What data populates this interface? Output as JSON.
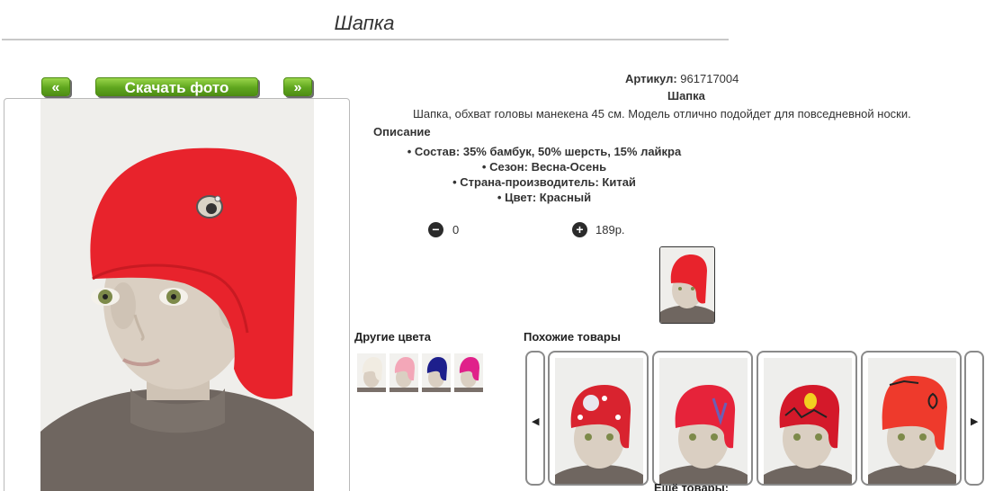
{
  "page": {
    "title": "Шапка"
  },
  "gallery": {
    "prev_label": "«",
    "download_label": "Скачать фото",
    "next_label": "»"
  },
  "product": {
    "article_label": "Артикул:",
    "article_value": "961717004",
    "name": "Шапка",
    "description": "Шапка, обхват головы манекена 45 см. Модель отлично подойдет для повседневной носки.",
    "desc_heading": "Описание",
    "properties": [
      "Состав: 35% бамбук, 50% шерсть, 15% лайкра",
      "Сезон: Весна-Осень",
      "Страна-производитель: Китай",
      "Цвет: Красный"
    ],
    "quantity": "0",
    "price": "189р.",
    "hat_color": "#e8232c"
  },
  "other_colors": {
    "heading": "Другие цвета",
    "swatches": [
      "#f1ece2",
      "#f3a7b8",
      "#1d1f8c",
      "#e0218a"
    ]
  },
  "similar": {
    "heading": "Похожие товары",
    "cards": [
      "#d9232f",
      "#e6233a",
      "#d4192a",
      "#ee3a2c"
    ],
    "more_label": "Ещё товары:"
  }
}
